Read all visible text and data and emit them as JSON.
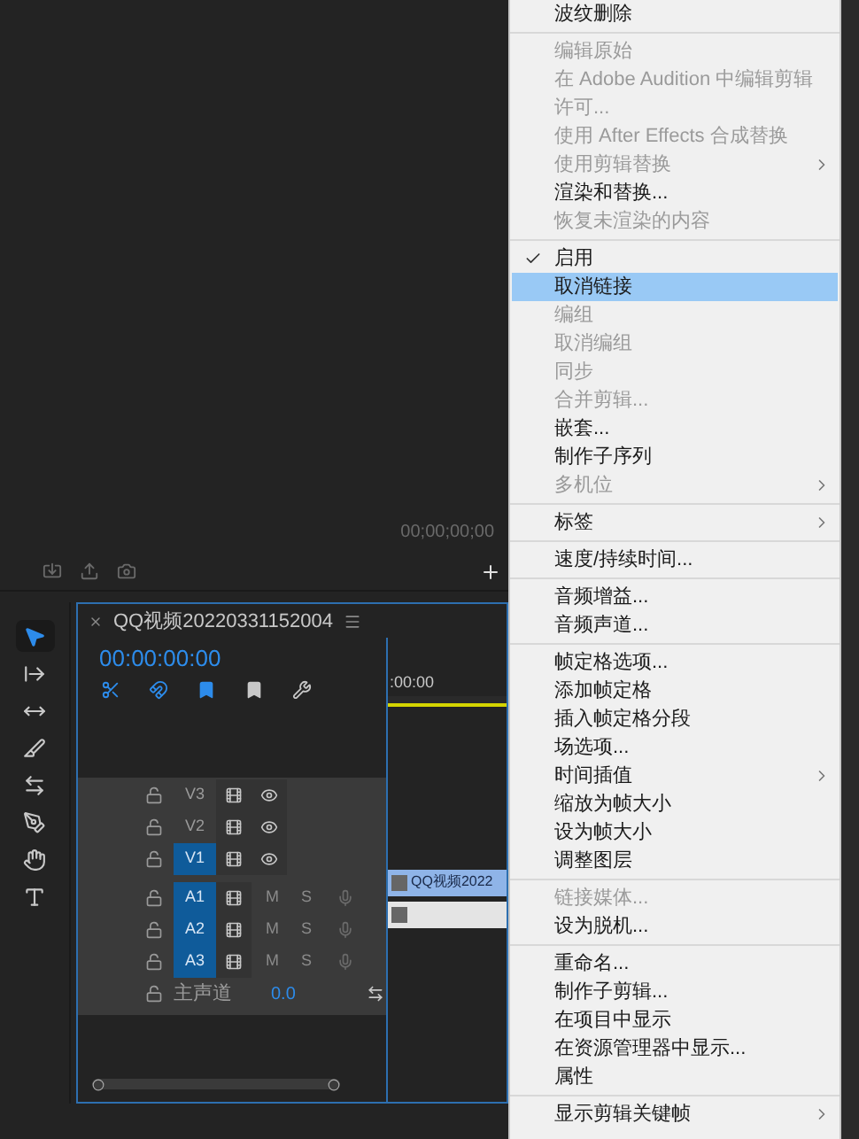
{
  "monitor": {
    "timecode": "00;00;00;00"
  },
  "tools": [
    {
      "kind": "selection",
      "selected": true
    },
    {
      "kind": "track-select",
      "selected": false
    },
    {
      "kind": "ripple",
      "selected": false
    },
    {
      "kind": "razor",
      "selected": false
    },
    {
      "kind": "slip",
      "selected": false
    },
    {
      "kind": "pen",
      "selected": false
    },
    {
      "kind": "hand",
      "selected": false
    },
    {
      "kind": "type",
      "selected": false
    }
  ],
  "timeline": {
    "tab_title": "QQ视频20220331152004",
    "timecode": "00:00:00:00",
    "ruler_label": ":00:00",
    "clip_label": "QQ视频2022",
    "tracks": [
      {
        "kind": "video",
        "name": "V3",
        "targeted": false
      },
      {
        "kind": "video",
        "name": "V2",
        "targeted": false
      },
      {
        "kind": "video",
        "name": "V1",
        "targeted": true
      },
      {
        "kind": "audio",
        "name": "A1",
        "targeted": true,
        "mute": "M",
        "solo": "S"
      },
      {
        "kind": "audio",
        "name": "A2",
        "targeted": true,
        "mute": "M",
        "solo": "S"
      },
      {
        "kind": "audio",
        "name": "A3",
        "targeted": true,
        "mute": "M",
        "solo": "S"
      },
      {
        "kind": "master",
        "name": "主声道",
        "value": "0.0"
      }
    ]
  },
  "menu": {
    "sections": [
      [
        {
          "label": "波纹删除",
          "disabled": false,
          "checked": false,
          "selected": false,
          "submenu": false
        }
      ],
      [
        {
          "label": "编辑原始",
          "disabled": true,
          "checked": false,
          "selected": false,
          "submenu": false
        },
        {
          "label": "在 Adobe Audition 中编辑剪辑",
          "disabled": true,
          "checked": false,
          "selected": false,
          "submenu": false
        },
        {
          "label": "许可...",
          "disabled": true,
          "checked": false,
          "selected": false,
          "submenu": false
        },
        {
          "label": "使用 After Effects 合成替换",
          "disabled": true,
          "checked": false,
          "selected": false,
          "submenu": false
        },
        {
          "label": "使用剪辑替换",
          "disabled": true,
          "checked": false,
          "selected": false,
          "submenu": true
        },
        {
          "label": "渲染和替换...",
          "disabled": false,
          "checked": false,
          "selected": false,
          "submenu": false
        },
        {
          "label": "恢复未渲染的内容",
          "disabled": true,
          "checked": false,
          "selected": false,
          "submenu": false
        }
      ],
      [
        {
          "label": "启用",
          "disabled": false,
          "checked": true,
          "selected": false,
          "submenu": false
        },
        {
          "label": "取消链接",
          "disabled": false,
          "checked": false,
          "selected": true,
          "submenu": false
        },
        {
          "label": "编组",
          "disabled": true,
          "checked": false,
          "selected": false,
          "submenu": false
        },
        {
          "label": "取消编组",
          "disabled": true,
          "checked": false,
          "selected": false,
          "submenu": false
        },
        {
          "label": "同步",
          "disabled": true,
          "checked": false,
          "selected": false,
          "submenu": false
        },
        {
          "label": "合并剪辑...",
          "disabled": true,
          "checked": false,
          "selected": false,
          "submenu": false
        },
        {
          "label": "嵌套...",
          "disabled": false,
          "checked": false,
          "selected": false,
          "submenu": false
        },
        {
          "label": "制作子序列",
          "disabled": false,
          "checked": false,
          "selected": false,
          "submenu": false
        },
        {
          "label": "多机位",
          "disabled": true,
          "checked": false,
          "selected": false,
          "submenu": true
        }
      ],
      [
        {
          "label": "标签",
          "disabled": false,
          "checked": false,
          "selected": false,
          "submenu": true
        }
      ],
      [
        {
          "label": "速度/持续时间...",
          "disabled": false,
          "checked": false,
          "selected": false,
          "submenu": false
        }
      ],
      [
        {
          "label": "音频增益...",
          "disabled": false,
          "checked": false,
          "selected": false,
          "submenu": false
        },
        {
          "label": "音频声道...",
          "disabled": false,
          "checked": false,
          "selected": false,
          "submenu": false
        }
      ],
      [
        {
          "label": "帧定格选项...",
          "disabled": false,
          "checked": false,
          "selected": false,
          "submenu": false
        },
        {
          "label": "添加帧定格",
          "disabled": false,
          "checked": false,
          "selected": false,
          "submenu": false
        },
        {
          "label": "插入帧定格分段",
          "disabled": false,
          "checked": false,
          "selected": false,
          "submenu": false
        },
        {
          "label": "场选项...",
          "disabled": false,
          "checked": false,
          "selected": false,
          "submenu": false
        },
        {
          "label": "时间插值",
          "disabled": false,
          "checked": false,
          "selected": false,
          "submenu": true
        },
        {
          "label": "缩放为帧大小",
          "disabled": false,
          "checked": false,
          "selected": false,
          "submenu": false
        },
        {
          "label": "设为帧大小",
          "disabled": false,
          "checked": false,
          "selected": false,
          "submenu": false
        },
        {
          "label": "调整图层",
          "disabled": false,
          "checked": false,
          "selected": false,
          "submenu": false
        }
      ],
      [
        {
          "label": "链接媒体...",
          "disabled": true,
          "checked": false,
          "selected": false,
          "submenu": false
        },
        {
          "label": "设为脱机...",
          "disabled": false,
          "checked": false,
          "selected": false,
          "submenu": false
        }
      ],
      [
        {
          "label": "重命名...",
          "disabled": false,
          "checked": false,
          "selected": false,
          "submenu": false
        },
        {
          "label": "制作子剪辑...",
          "disabled": false,
          "checked": false,
          "selected": false,
          "submenu": false
        },
        {
          "label": "在项目中显示",
          "disabled": false,
          "checked": false,
          "selected": false,
          "submenu": false
        },
        {
          "label": "在资源管理器中显示...",
          "disabled": false,
          "checked": false,
          "selected": false,
          "submenu": false
        },
        {
          "label": "属性",
          "disabled": false,
          "checked": false,
          "selected": false,
          "submenu": false
        }
      ],
      [
        {
          "label": "显示剪辑关键帧",
          "disabled": false,
          "checked": false,
          "selected": false,
          "submenu": true
        }
      ]
    ]
  }
}
